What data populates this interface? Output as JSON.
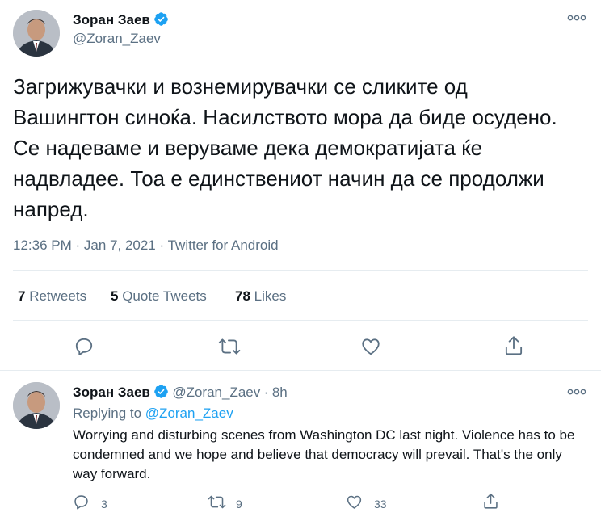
{
  "main_tweet": {
    "author_name": "Зоран Заев",
    "handle": "@Zoran_Zaev",
    "text": "Загрижувачки и вознемирувачки се сликите од Вашингтон синоќа. Насилството мора да биде осудено. Се надеваме и веруваме дека демократијата ќе надвладее. Тоа е единствениот начин да се продолжи напред.",
    "time": "12:36 PM",
    "date": "Jan 7, 2021",
    "source": "Twitter for Android",
    "sep": "·",
    "stats": {
      "retweets_count": "7",
      "retweets_label": "Retweets",
      "quotes_count": "5",
      "quotes_label": "Quote Tweets",
      "likes_count": "78",
      "likes_label": "Likes"
    }
  },
  "reply_tweet": {
    "author_name": "Зоран Заев",
    "handle": "@Zoran_Zaev",
    "sep": "·",
    "age": "8h",
    "replying_label": "Replying to",
    "replying_handle": "@Zoran_Zaev",
    "text": "Worrying and disturbing scenes from Washington DC last night. Violence has to be condemned and we hope and believe that democracy will prevail. That's the only way forward.",
    "replies": "3",
    "retweets": "9",
    "likes": "33"
  },
  "colors": {
    "accent": "#1da1f2",
    "secondary": "#5b7083",
    "divider": "#e6ecf0"
  }
}
